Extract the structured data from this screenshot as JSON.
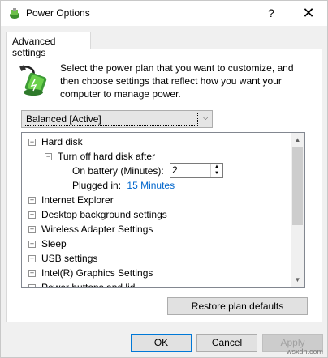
{
  "window": {
    "title": "Power Options",
    "help_glyph": "?",
    "close_glyph": "✕"
  },
  "tab": {
    "label": "Advanced settings"
  },
  "intro": {
    "text": "Select the power plan that you want to customize, and then choose settings that reflect how you want your computer to manage power."
  },
  "plan_select": {
    "value": "Balanced [Active]"
  },
  "tree": {
    "hard_disk": "Hard disk",
    "turn_off_after": "Turn off hard disk after",
    "on_battery_label": "On battery (Minutes):",
    "on_battery_value": "2",
    "plugged_in_label": "Plugged in:",
    "plugged_in_value": "15 Minutes",
    "items": [
      "Internet Explorer",
      "Desktop background settings",
      "Wireless Adapter Settings",
      "Sleep",
      "USB settings",
      "Intel(R) Graphics Settings",
      "Power buttons and lid"
    ]
  },
  "buttons": {
    "restore": "Restore plan defaults",
    "ok": "OK",
    "cancel": "Cancel",
    "apply": "Apply"
  },
  "watermark": "wsxdn.com",
  "colors": {
    "link": "#0066cc",
    "accent": "#0078d7"
  }
}
